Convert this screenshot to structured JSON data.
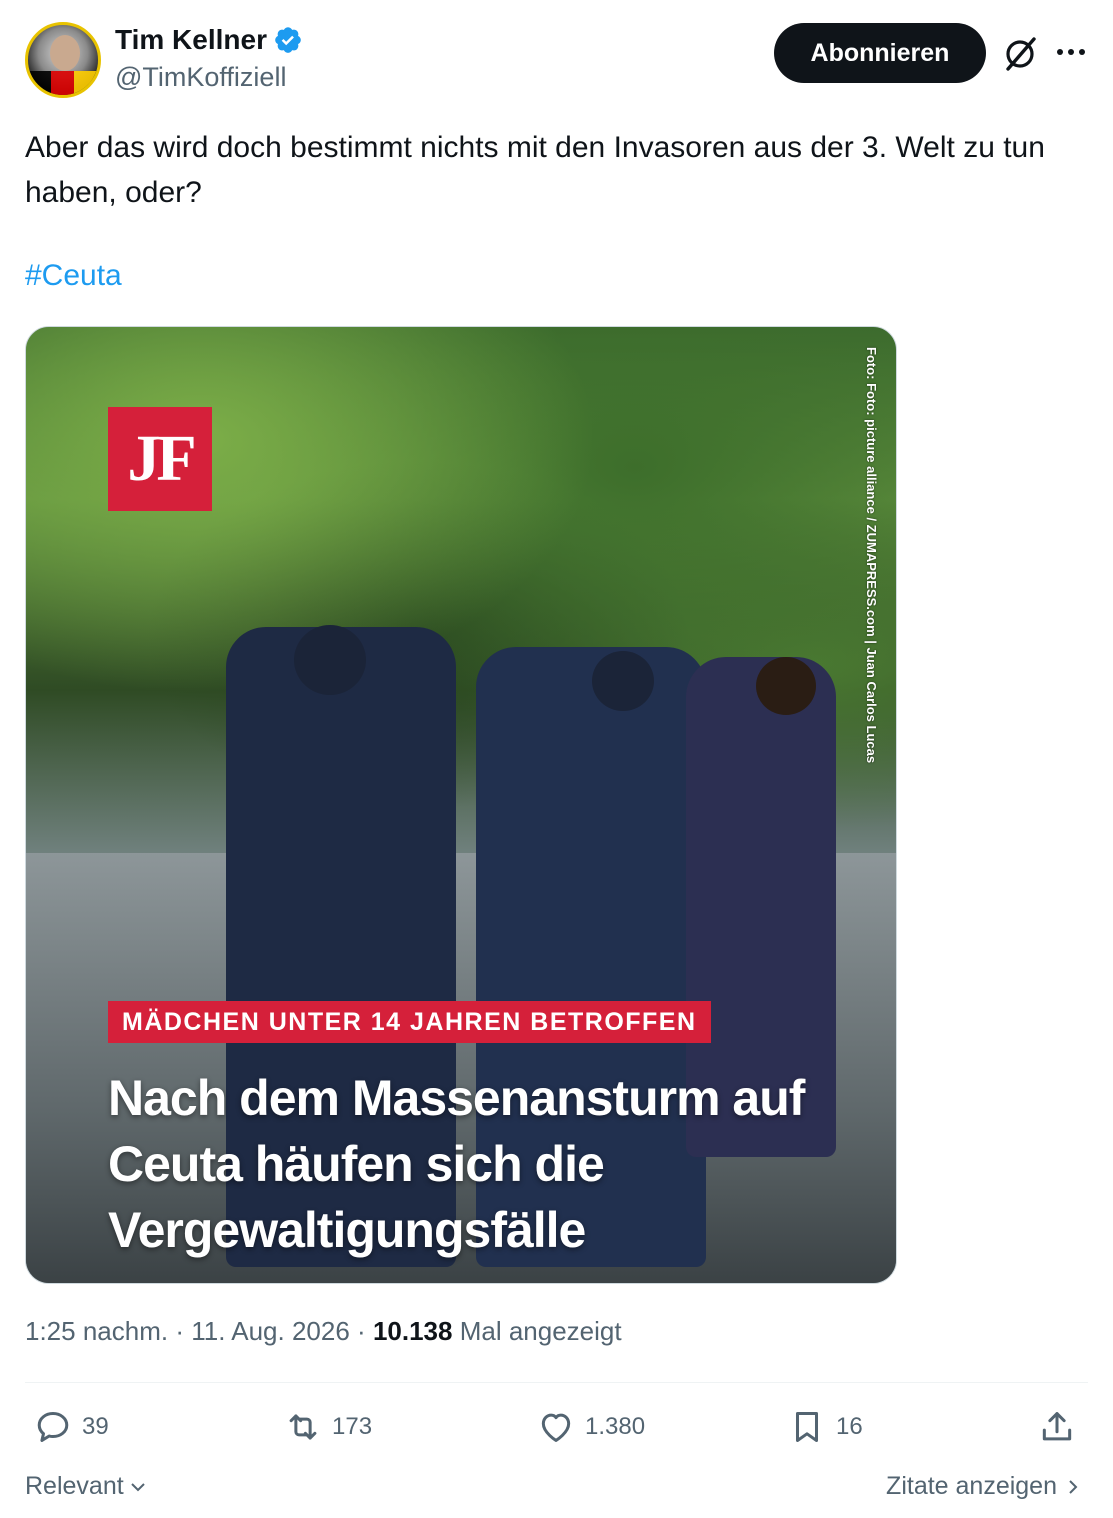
{
  "author": {
    "display_name": "Tim Kellner",
    "handle": "@TimKoffiziell",
    "verified": true
  },
  "header": {
    "follow_label": "Abonnieren",
    "icons": [
      "grok-icon",
      "more-icon"
    ]
  },
  "tweet": {
    "text": "Aber das wird doch bestimmt nichts mit den Invasoren aus der 3. Welt zu tun haben, oder?",
    "hashtag": "#Ceuta"
  },
  "media": {
    "logo": "JF",
    "credit": "Foto: Foto: picture alliance / ZUMAPRESS.com | Juan Carlos Lucas",
    "kicker": "MÄDCHEN UNTER 14 JAHREN BETROFFEN",
    "headline": "Nach dem Massenansturm auf Ceuta häufen sich die Vergewaltigungsfälle"
  },
  "meta": {
    "time": "1:25 nachm.",
    "date": "11. Aug. 2026",
    "separator": "·",
    "views": "10.138",
    "views_label": "Mal angezeigt"
  },
  "actions": {
    "replies": "39",
    "retweets": "173",
    "likes": "1.380",
    "bookmarks": "16"
  },
  "footer": {
    "sort_label": "Relevant",
    "quotes_label": "Zitate anzeigen"
  },
  "colors": {
    "accent": "#1d9bf0",
    "text": "#0f1419",
    "muted": "#536471",
    "brand_red": "#d5203a"
  }
}
